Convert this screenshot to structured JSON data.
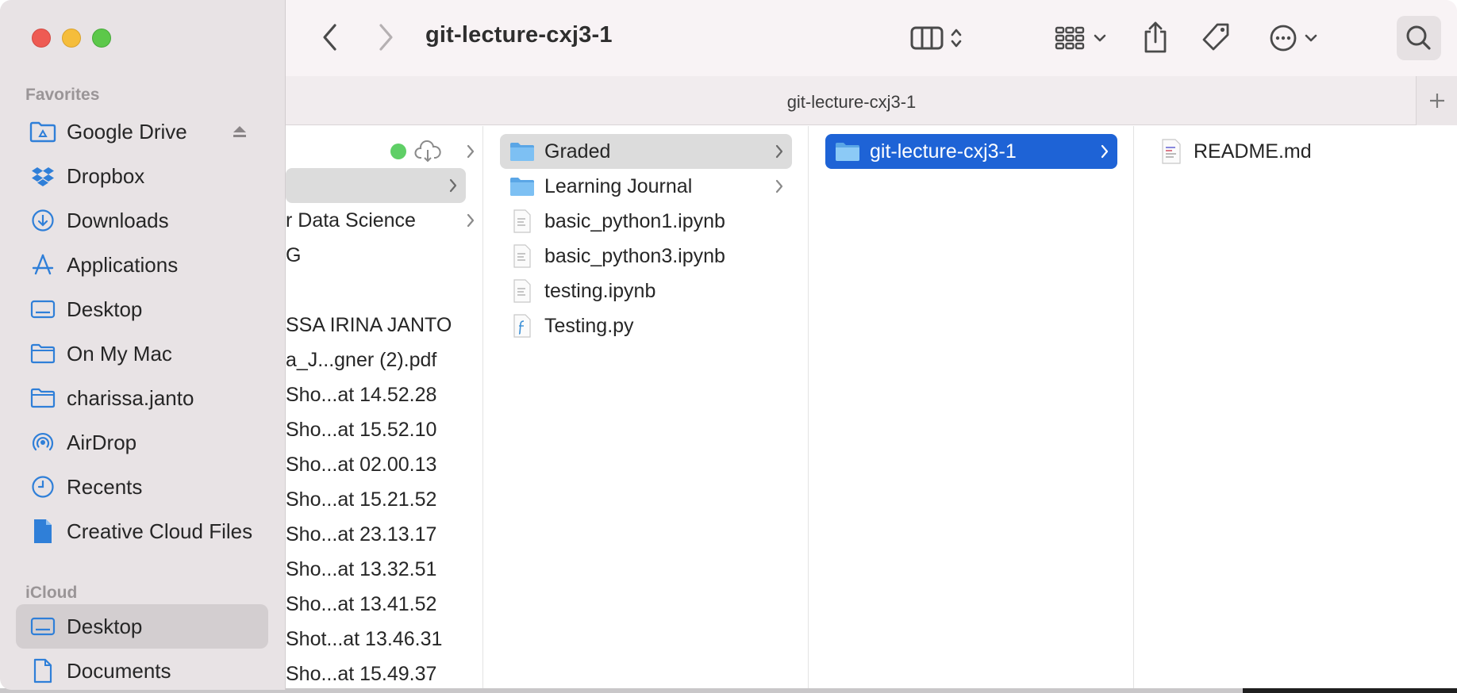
{
  "window": {
    "title": "git-lecture-cxj3-1",
    "tab_title": "git-lecture-cxj3-1"
  },
  "toolbar": {
    "back_icon": "chevron-left-icon",
    "forward_icon": "chevron-right-icon",
    "view_icon": "column-view-icon",
    "group_icon": "grid-icon",
    "share_icon": "share-icon",
    "tag_icon": "tag-icon",
    "more_icon": "ellipsis-circle-icon",
    "search_icon": "search-icon",
    "add_tab_icon": "plus-icon"
  },
  "sidebar": {
    "favorites_label": "Favorites",
    "icloud_label": "iCloud",
    "favorites": [
      {
        "label": "Google Drive",
        "icon": "google-drive-folder-icon"
      },
      {
        "label": "Dropbox",
        "icon": "dropbox-icon"
      },
      {
        "label": "Downloads",
        "icon": "downloads-icon"
      },
      {
        "label": "Applications",
        "icon": "applications-icon"
      },
      {
        "label": "Desktop",
        "icon": "desktop-icon"
      },
      {
        "label": "On My Mac",
        "icon": "folder-icon"
      },
      {
        "label": "charissa.janto",
        "icon": "folder-icon"
      },
      {
        "label": "AirDrop",
        "icon": "airdrop-icon"
      },
      {
        "label": "Recents",
        "icon": "clock-icon"
      },
      {
        "label": "Creative Cloud Files",
        "icon": "document-icon"
      }
    ],
    "icloud": [
      {
        "label": "Desktop",
        "icon": "desktop-icon"
      },
      {
        "label": "Documents",
        "icon": "document-icon"
      }
    ]
  },
  "columns": {
    "col1": [
      {
        "label": ""
      },
      {
        "label": ""
      },
      {
        "label": "r Data Science"
      },
      {
        "label": "G"
      },
      {
        "label": ""
      },
      {
        "label": "SSA IRINA JANTO"
      },
      {
        "label": "a_J...gner (2).pdf"
      },
      {
        "label": "Sho...at 14.52.28"
      },
      {
        "label": "Sho...at 15.52.10"
      },
      {
        "label": "Sho...at 02.00.13"
      },
      {
        "label": "Sho...at 15.21.52"
      },
      {
        "label": "Sho...at 23.13.17"
      },
      {
        "label": "Sho...at 13.32.51"
      },
      {
        "label": "Sho...at 13.41.52"
      },
      {
        "label": "Shot...at 13.46.31"
      },
      {
        "label": "Sho...at 15.49.37"
      }
    ],
    "col2": [
      {
        "label": "Graded",
        "type": "folder"
      },
      {
        "label": "Learning Journal",
        "type": "folder"
      },
      {
        "label": "basic_python1.ipynb",
        "type": "file"
      },
      {
        "label": "basic_python3.ipynb",
        "type": "file"
      },
      {
        "label": "testing.ipynb",
        "type": "file"
      },
      {
        "label": "Testing.py",
        "type": "python"
      }
    ],
    "col3": [
      {
        "label": "git-lecture-cxj3-1",
        "type": "folder"
      }
    ],
    "col4": [
      {
        "label": "README.md",
        "type": "markdown"
      }
    ]
  },
  "colors": {
    "selection_blue": "#1e63d6",
    "folder_blue": "#6cb4ee",
    "sync_green": "#5fcf66"
  }
}
